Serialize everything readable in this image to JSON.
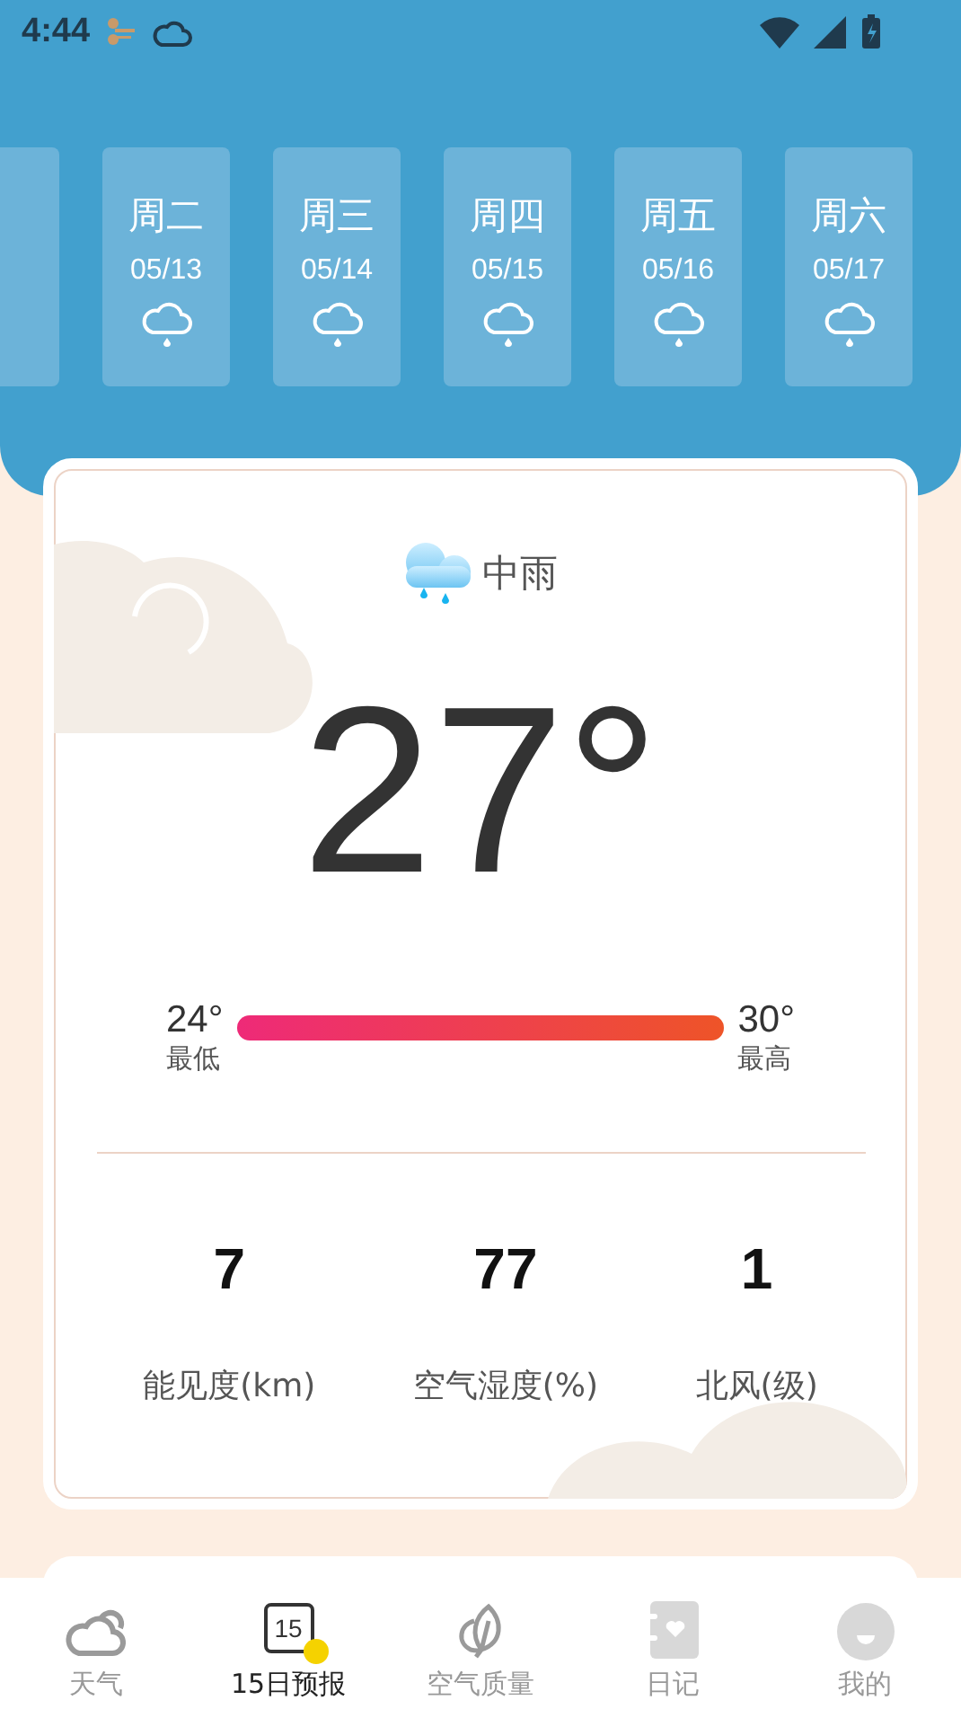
{
  "status_bar": {
    "time": "4:44"
  },
  "days": [
    {
      "weekday": "周二",
      "date": "05/13",
      "kind": "rain"
    },
    {
      "weekday": "周三",
      "date": "05/14",
      "kind": "rain"
    },
    {
      "weekday": "周四",
      "date": "05/15",
      "kind": "rain"
    },
    {
      "weekday": "周五",
      "date": "05/16",
      "kind": "rain"
    },
    {
      "weekday": "周六",
      "date": "05/17",
      "kind": "rain"
    }
  ],
  "current": {
    "condition": "中雨",
    "temperature": "27°",
    "low": "24°",
    "low_label": "最低",
    "high": "30°",
    "high_label": "最高",
    "stats": [
      {
        "value": "7",
        "label": "能见度(km)"
      },
      {
        "value": "77",
        "label": "空气湿度(%)"
      },
      {
        "value": "1",
        "label": "北风(级)"
      }
    ]
  },
  "nav": [
    {
      "label": "天气",
      "kind": "cloud",
      "selected": false
    },
    {
      "label": "15日预报",
      "kind": "calendar",
      "badge": "15",
      "selected": true
    },
    {
      "label": "空气质量",
      "kind": "leaf",
      "selected": false
    },
    {
      "label": "日记",
      "kind": "diary",
      "selected": false
    },
    {
      "label": "我的",
      "kind": "profile",
      "selected": false
    }
  ]
}
